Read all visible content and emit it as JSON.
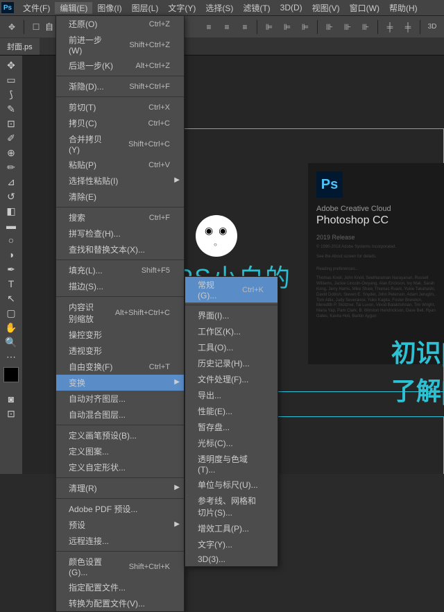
{
  "menubar": {
    "items": [
      "文件(F)",
      "编辑(E)",
      "图像(I)",
      "图层(L)",
      "文字(Y)",
      "选择(S)",
      "滤镜(T)",
      "3D(D)",
      "视图(V)",
      "窗口(W)",
      "帮助(H)"
    ]
  },
  "tab": "封面.ps",
  "editMenu": [
    {
      "l": "还原(O)",
      "s": "Ctrl+Z"
    },
    {
      "l": "前进一步(W)",
      "s": "Shift+Ctrl+Z"
    },
    {
      "l": "后退一步(K)",
      "s": "Alt+Ctrl+Z"
    },
    {
      "sep": 1
    },
    {
      "l": "渐隐(D)...",
      "s": "Shift+Ctrl+F"
    },
    {
      "sep": 1
    },
    {
      "l": "剪切(T)",
      "s": "Ctrl+X"
    },
    {
      "l": "拷贝(C)",
      "s": "Ctrl+C"
    },
    {
      "l": "合并拷贝(Y)",
      "s": "Shift+Ctrl+C"
    },
    {
      "l": "粘贴(P)",
      "s": "Ctrl+V"
    },
    {
      "l": "选择性粘贴(I)",
      "sub": 1
    },
    {
      "l": "清除(E)"
    },
    {
      "sep": 1
    },
    {
      "l": "搜索",
      "s": "Ctrl+F"
    },
    {
      "l": "拼写检查(H)..."
    },
    {
      "l": "查找和替换文本(X)..."
    },
    {
      "sep": 1
    },
    {
      "l": "填充(L)...",
      "s": "Shift+F5"
    },
    {
      "l": "描边(S)..."
    },
    {
      "sep": 1
    },
    {
      "l": "内容识别缩放",
      "s": "Alt+Shift+Ctrl+C"
    },
    {
      "l": "操控变形"
    },
    {
      "l": "透视变形"
    },
    {
      "l": "自由变换(F)",
      "s": "Ctrl+T"
    },
    {
      "l": "变换",
      "sub": 1,
      "hl": 1
    },
    {
      "l": "自动对齐图层..."
    },
    {
      "l": "自动混合图层..."
    },
    {
      "sep": 1
    },
    {
      "l": "定义画笔预设(B)..."
    },
    {
      "l": "定义图案..."
    },
    {
      "l": "定义自定形状..."
    },
    {
      "sep": 1
    },
    {
      "l": "清理(R)",
      "sub": 1
    },
    {
      "sep": 1
    },
    {
      "l": "Adobe PDF 预设..."
    },
    {
      "l": "预设",
      "sub": 1
    },
    {
      "l": "远程连接..."
    },
    {
      "sep": 1
    },
    {
      "l": "颜色设置(G)...",
      "s": "Shift+Ctrl+K"
    },
    {
      "l": "指定配置文件..."
    },
    {
      "l": "转换为配置文件(V)..."
    }
  ],
  "subMenu": [
    {
      "l": "常规(G)...",
      "s": "Ctrl+K",
      "hl": 1
    },
    {
      "sep": 1
    },
    {
      "l": "界面(I)..."
    },
    {
      "l": "工作区(K)..."
    },
    {
      "l": "工具(O)..."
    },
    {
      "l": "历史记录(H)..."
    },
    {
      "l": "文件处理(F)..."
    },
    {
      "l": "导出..."
    },
    {
      "l": "性能(E)..."
    },
    {
      "l": "暂存盘..."
    },
    {
      "l": "光标(C)..."
    },
    {
      "l": "透明度与色域(T)..."
    },
    {
      "l": "单位与标尺(U)..."
    },
    {
      "l": "参考线、网格和切片(S)..."
    },
    {
      "l": "增效工具(P)..."
    },
    {
      "l": "文字(Y)..."
    },
    {
      "l": "3D(3)..."
    }
  ],
  "splash": {
    "cloud": "Adobe Creative Cloud",
    "app": "Photoshop CC",
    "rel": "2019 Release",
    "cp": "© 1990-2018 Adobe Systems Incorporated.",
    "about": "See the About screen for details.",
    "read": "Reading preferences..."
  },
  "canvas": {
    "big": "PS小白的",
    "c1": "初识|",
    "c2": "了解|"
  }
}
